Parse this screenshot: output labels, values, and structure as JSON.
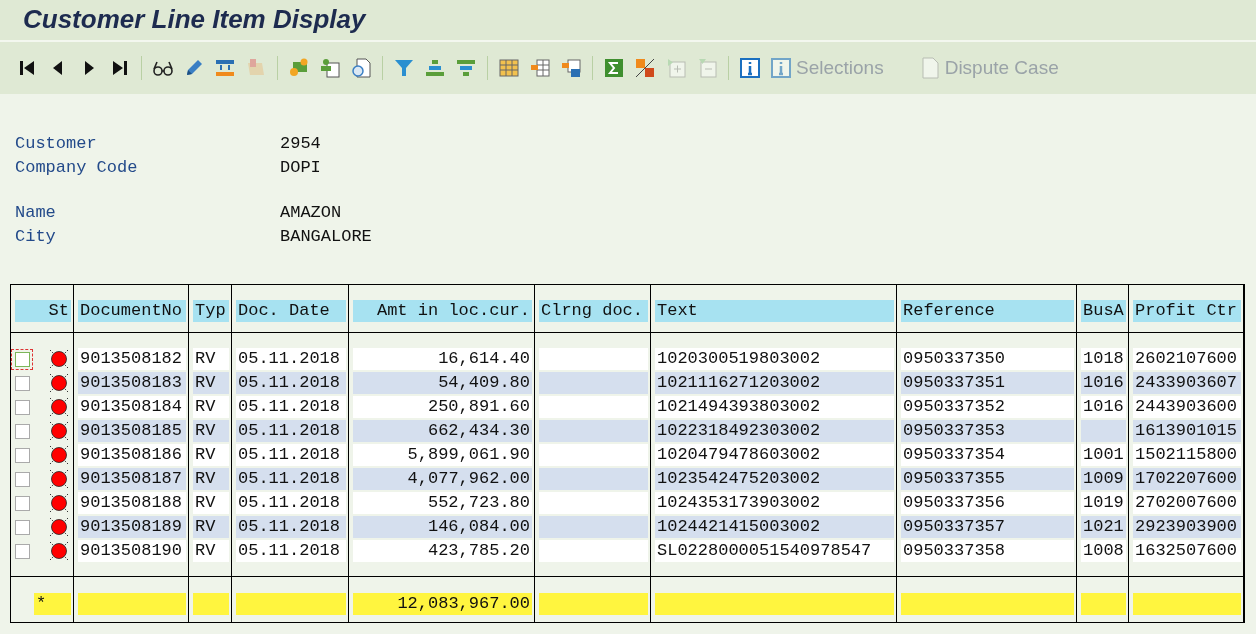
{
  "window": {
    "title": "Customer Line Item Display"
  },
  "toolbar": [
    [
      {
        "disabled": false
      },
      {
        "disabled": false
      },
      {
        "disabled": false
      },
      {
        "disabled": false
      }
    ],
    [
      {
        "disabled": false
      },
      {
        "disabled": false
      },
      {
        "disabled": false
      },
      {
        "disabled": true
      }
    ],
    [
      {
        "disabled": false
      },
      {
        "disabled": false
      },
      {
        "disabled": false
      }
    ],
    [
      {
        "disabled": false
      },
      {
        "disabled": false
      },
      {
        "disabled": false
      }
    ],
    [
      {
        "disabled": false
      },
      {
        "disabled": false
      },
      {
        "disabled": false
      }
    ],
    [
      {
        "disabled": false
      },
      {
        "disabled": false
      },
      {
        "disabled": true
      },
      {
        "disabled": true
      }
    ],
    [
      {
        "disabled": false
      },
      {
        "disabled": true,
        "label": "Selections"
      },
      {
        "disabled": true,
        "label": "Dispute Case"
      }
    ]
  ],
  "header_fields": [
    [
      {
        "label": "Customer",
        "value": "2954"
      },
      {
        "label": "Company Code",
        "value": "DOPI"
      }
    ],
    [
      {
        "label": "Name",
        "value": "AMAZON"
      },
      {
        "label": "City",
        "value": "BANGALORE"
      }
    ]
  ],
  "table": {
    "status_column": "St",
    "columns": [
      "DocumentNo",
      "Typ",
      "Doc. Date",
      "Amt in loc.cur.",
      "Clrng doc.",
      "Text",
      "Reference",
      "BusA",
      "Profit Ctr"
    ],
    "rows": [
      {
        "selected": false,
        "focused": true,
        "color": "#ff0000",
        "cells": [
          "9013508182",
          "RV",
          "05.11.2018",
          "16,614.40",
          "",
          "1020300519803002",
          "0950337350",
          "1018",
          "2602107600"
        ]
      },
      {
        "selected": false,
        "focused": false,
        "color": "#ff0000",
        "cells": [
          "9013508183",
          "RV",
          "05.11.2018",
          "54,409.80",
          "",
          "1021116271203002",
          "0950337351",
          "1016",
          "2433903607"
        ]
      },
      {
        "selected": false,
        "focused": false,
        "color": "#ff0000",
        "cells": [
          "9013508184",
          "RV",
          "05.11.2018",
          "250,891.60",
          "",
          "1021494393803002",
          "0950337352",
          "1016",
          "2443903600"
        ]
      },
      {
        "selected": false,
        "focused": false,
        "color": "#ff0000",
        "cells": [
          "9013508185",
          "RV",
          "05.11.2018",
          "662,434.30",
          "",
          "1022318492303002",
          "0950337353",
          "",
          "1613901015"
        ]
      },
      {
        "selected": false,
        "focused": false,
        "color": "#ff0000",
        "cells": [
          "9013508186",
          "RV",
          "05.11.2018",
          "5,899,061.90",
          "",
          "1020479478603002",
          "0950337354",
          "1001",
          "1502115800"
        ]
      },
      {
        "selected": false,
        "focused": false,
        "color": "#ff0000",
        "cells": [
          "9013508187",
          "RV",
          "05.11.2018",
          "4,077,962.00",
          "",
          "1023542475203002",
          "0950337355",
          "1009",
          "1702207600"
        ]
      },
      {
        "selected": false,
        "focused": false,
        "color": "#ff0000",
        "cells": [
          "9013508188",
          "RV",
          "05.11.2018",
          "552,723.80",
          "",
          "1024353173903002",
          "0950337356",
          "1019",
          "2702007600"
        ]
      },
      {
        "selected": false,
        "focused": false,
        "color": "#ff0000",
        "cells": [
          "9013508189",
          "RV",
          "05.11.2018",
          "146,084.00",
          "",
          "1024421415003002",
          "0950337357",
          "1021",
          "2923903900"
        ]
      },
      {
        "selected": false,
        "focused": false,
        "color": "#ff0000",
        "cells": [
          "9013508190",
          "RV",
          "05.11.2018",
          "423,785.20",
          "",
          "SL0228000051540978547",
          "0950337358",
          "1008",
          "1632507600"
        ]
      }
    ],
    "total": {
      "marker": "*",
      "cells": [
        "",
        "",
        "",
        "12,083,967.00",
        "",
        "",
        "",
        "",
        ""
      ]
    }
  }
}
